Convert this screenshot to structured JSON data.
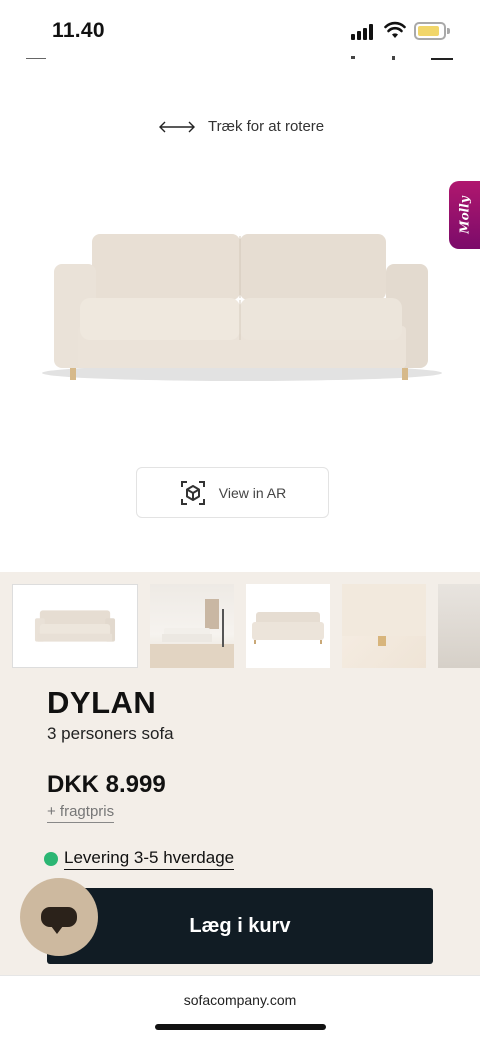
{
  "status_bar": {
    "time": "11.40",
    "battery_level": 0.88,
    "battery_color": "#f1d66a"
  },
  "viewer": {
    "rotate_hint": "Træk for at rotere",
    "molly_label": "Molly",
    "ar_button_label": "View in AR"
  },
  "gallery": {
    "thumbnails": [
      "sofa-front",
      "sofa-room",
      "sofa-angle",
      "sofa-leg-closeup",
      "sofa-room-partial"
    ]
  },
  "product": {
    "name": "DYLAN",
    "subtitle": "3 personers sofa",
    "price": "DKK 8.999",
    "freight": "+ fragtpris",
    "delivery": "Levering 3-5 hverdage",
    "delivery_status_color": "#2bb673",
    "cart_button": "Læg i kurv"
  },
  "browser": {
    "url": "sofacompany.com"
  },
  "colors": {
    "accent_dark": "#111c24",
    "section_bg": "#f3eee8",
    "molly_brand": "#b0176e"
  }
}
